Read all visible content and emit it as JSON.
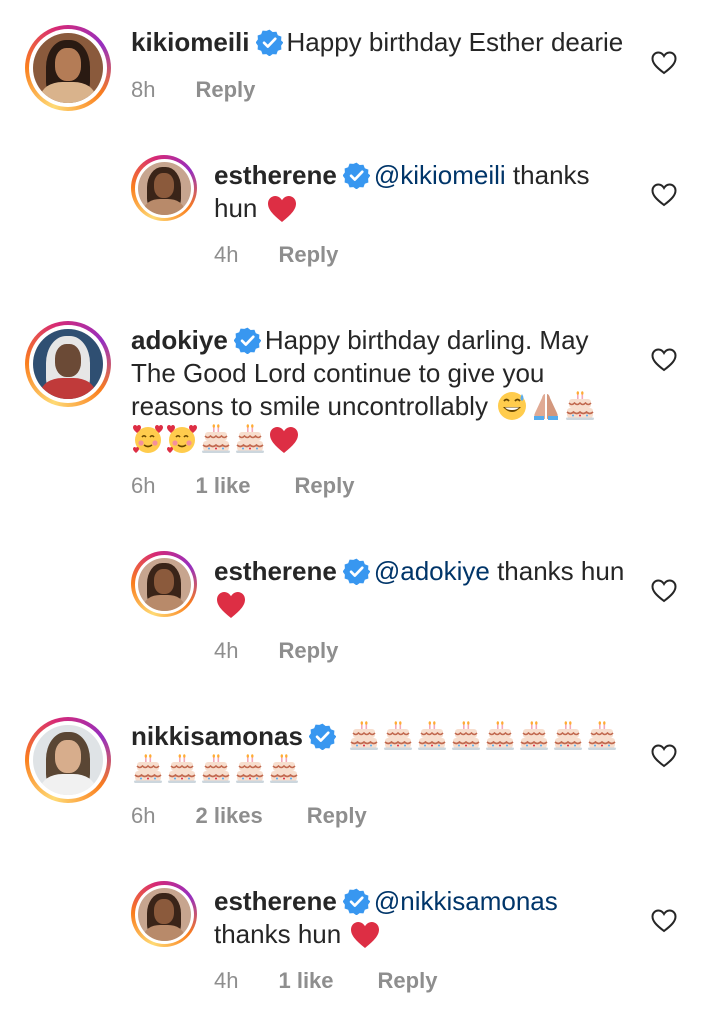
{
  "comments": [
    {
      "username": "kikiomeili",
      "text": "Happy birthday Esther dearie",
      "time": "8h",
      "reply": "Reply"
    },
    {
      "username": "estherene",
      "mention": "@kikiomeili",
      "text_line1": " thanks",
      "text_line2": "hun",
      "time": "4h",
      "reply": "Reply"
    },
    {
      "username": "adokiye",
      "text_line1": "Happy birthday darling. May",
      "text_line2": "The Good Lord continue to give you",
      "text_line3": "reasons to smile uncontrollably",
      "time": "6h",
      "likes": "1 like",
      "reply": "Reply"
    },
    {
      "username": "estherene",
      "mention": "@adokiye",
      "text_line1": " thanks hun",
      "time": "4h",
      "reply": "Reply"
    },
    {
      "username": "nikkisamonas",
      "time": "6h",
      "likes": "2 likes",
      "reply": "Reply"
    },
    {
      "username": "estherene",
      "mention": "@nikkisamonas",
      "text_line2": "thanks hun",
      "time": "4h",
      "likes": "1 like",
      "reply": "Reply"
    }
  ],
  "icons": {
    "like": "heart-outline-icon",
    "verified": "verified-badge-icon",
    "emojis": [
      "birthday-cake",
      "red-heart",
      "grinning-sweat-face",
      "folded-hands",
      "smiling-face-with-hearts"
    ]
  },
  "colors": {
    "verified_blue": "#3897f0",
    "mention_blue": "#003569",
    "meta_gray": "#8e8e8e",
    "text": "#262626",
    "heart_red": "#dd2e44"
  }
}
